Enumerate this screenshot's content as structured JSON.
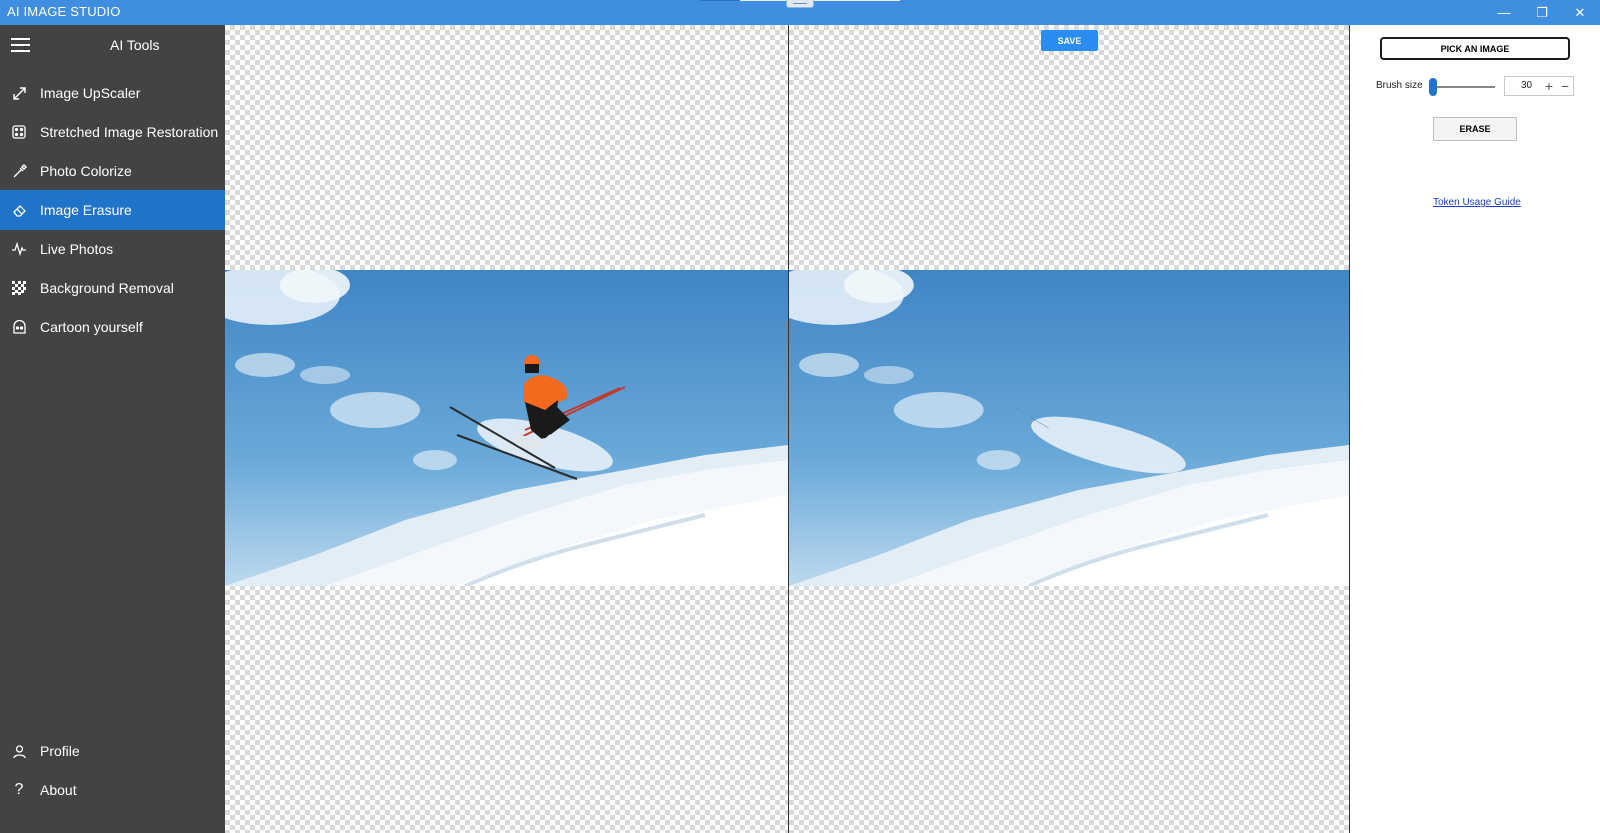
{
  "window": {
    "title": "AI IMAGE STUDIO",
    "controls": {
      "minimize": "—",
      "restore": "❐",
      "close": "✕"
    }
  },
  "sidebar": {
    "title": "AI Tools",
    "items": [
      {
        "label": "Image UpScaler",
        "icon": "expand-arrows-icon"
      },
      {
        "label": "Stretched Image Restoration",
        "icon": "dice-icon"
      },
      {
        "label": "Photo Colorize",
        "icon": "eyedropper-icon"
      },
      {
        "label": "Image Erasure",
        "icon": "eraser-icon",
        "active": true
      },
      {
        "label": "Live Photos",
        "icon": "pulse-icon"
      },
      {
        "label": "Background Removal",
        "icon": "checkerboard-icon"
      },
      {
        "label": "Cartoon yourself",
        "icon": "cartoon-face-icon"
      }
    ],
    "footer": [
      {
        "label": "Profile",
        "icon": "person-icon"
      },
      {
        "label": "About",
        "icon": "question-icon"
      }
    ]
  },
  "canvas": {
    "save_label": "SAVE"
  },
  "panel": {
    "pick_label": "PICK AN IMAGE",
    "brush_label": "Brush size",
    "brush_value": "30",
    "brush_level": 0.05,
    "plus": "+",
    "minus": "−",
    "erase_label": "ERASE",
    "guide_link": "Token Usage Guide"
  },
  "colors": {
    "titlebar": "#3f8ee0",
    "sidebar": "#434343",
    "active_item": "#1f73c9",
    "save_button": "#2b8cf1"
  }
}
